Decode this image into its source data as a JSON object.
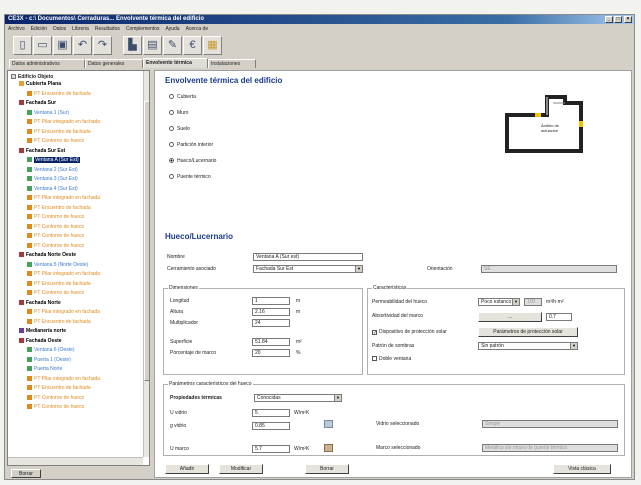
{
  "window": {
    "title": "CE3X - c:\\ Documentos\\ Cerraduras... Envolvente térmica del edificio"
  },
  "menu": [
    "Archivo",
    "Edición",
    "Datos",
    "Libreria",
    "Resultados",
    "Complementos",
    "Ayuda",
    "Acerca de"
  ],
  "tabs": [
    "Datos administrativos",
    "Datos generales",
    "Envolvente térmica",
    "Instalaciones"
  ],
  "tree": {
    "root": "Edificio Objeto",
    "items": [
      {
        "t": "Cubierta Plana",
        "d": 1,
        "c": "#000",
        "i": "#e2a23a",
        "b": true
      },
      {
        "t": "PT Encuentro de fachada",
        "d": 2,
        "c": "#e08a1e",
        "i": "#e08a1e"
      },
      {
        "t": "Fachada Sur",
        "d": 1,
        "c": "#000",
        "i": "#a63a3a",
        "b": true
      },
      {
        "t": "Ventana 1 (Sur)",
        "d": 2,
        "c": "#3a7acc",
        "i": "#4aa05a"
      },
      {
        "t": "PT Pilar integrado en fachada",
        "d": 2,
        "c": "#e08a1e",
        "i": "#e08a1e"
      },
      {
        "t": "PT Encuentro de fachada",
        "d": 2,
        "c": "#e08a1e",
        "i": "#e08a1e"
      },
      {
        "t": "PT Contorno de hueco",
        "d": 2,
        "c": "#e08a1e",
        "i": "#e08a1e"
      },
      {
        "t": "Fachada Sur Est",
        "d": 1,
        "c": "#000",
        "i": "#a63a3a",
        "b": true
      },
      {
        "t": "Ventana A (Sur Est)",
        "d": 2,
        "c": "#fff",
        "i": "#4aa05a",
        "s": true
      },
      {
        "t": "Ventana 2 (Sur Est)",
        "d": 2,
        "c": "#3a7acc",
        "i": "#4aa05a"
      },
      {
        "t": "Ventana 3 (Sur Est)",
        "d": 2,
        "c": "#3a7acc",
        "i": "#4aa05a"
      },
      {
        "t": "Ventana 4 (Sur Est)",
        "d": 2,
        "c": "#3a7acc",
        "i": "#4aa05a"
      },
      {
        "t": "PT Pilar integrado en fachada",
        "d": 2,
        "c": "#e08a1e",
        "i": "#e08a1e"
      },
      {
        "t": "PT Encuentro de fachada",
        "d": 2,
        "c": "#e08a1e",
        "i": "#e08a1e"
      },
      {
        "t": "PT Contorno de hueco",
        "d": 2,
        "c": "#e08a1e",
        "i": "#e08a1e"
      },
      {
        "t": "PT Contorno de hueco",
        "d": 2,
        "c": "#e08a1e",
        "i": "#e08a1e"
      },
      {
        "t": "PT Contorno de hueco",
        "d": 2,
        "c": "#e08a1e",
        "i": "#e08a1e"
      },
      {
        "t": "PT Contorno de hueco",
        "d": 2,
        "c": "#e08a1e",
        "i": "#e08a1e"
      },
      {
        "t": "Fachada Norte Oeste",
        "d": 1,
        "c": "#000",
        "i": "#a63a3a",
        "b": true
      },
      {
        "t": "Ventana 5 (Norte Oeste)",
        "d": 2,
        "c": "#3a7acc",
        "i": "#4aa05a"
      },
      {
        "t": "PT Pilar integrado en fachada",
        "d": 2,
        "c": "#e08a1e",
        "i": "#e08a1e"
      },
      {
        "t": "PT Encuentro de fachada",
        "d": 2,
        "c": "#e08a1e",
        "i": "#e08a1e"
      },
      {
        "t": "PT Contorno de hueco",
        "d": 2,
        "c": "#e08a1e",
        "i": "#e08a1e"
      },
      {
        "t": "Fachada Norte",
        "d": 1,
        "c": "#000",
        "i": "#a63a3a",
        "b": true
      },
      {
        "t": "PT Pilar integrado en fachada",
        "d": 2,
        "c": "#e08a1e",
        "i": "#e08a1e"
      },
      {
        "t": "PT Encuentro de fachada",
        "d": 2,
        "c": "#e08a1e",
        "i": "#e08a1e"
      },
      {
        "t": "Medianería norte",
        "d": 1,
        "c": "#000",
        "i": "#6a3aa6",
        "b": true
      },
      {
        "t": "Fachada Oeste",
        "d": 1,
        "c": "#000",
        "i": "#a63a3a",
        "b": true
      },
      {
        "t": "Ventana 6 (Oeste)",
        "d": 2,
        "c": "#3a7acc",
        "i": "#4aa05a"
      },
      {
        "t": "Puerta 1 (Oeste)",
        "d": 2,
        "c": "#3a7acc",
        "i": "#4aa05a"
      },
      {
        "t": "Puerta Norte",
        "d": 2,
        "c": "#3a7acc",
        "i": "#4aa05a"
      },
      {
        "t": "PT Pilar integrado en fachada",
        "d": 2,
        "c": "#e08a1e",
        "i": "#e08a1e"
      },
      {
        "t": "PT Encuentro de fachada",
        "d": 2,
        "c": "#e08a1e",
        "i": "#e08a1e"
      },
      {
        "t": "PT Contorno de hueco",
        "d": 2,
        "c": "#e08a1e",
        "i": "#e08a1e"
      },
      {
        "t": "PT Contorno de hueco",
        "d": 2,
        "c": "#e08a1e",
        "i": "#e08a1e"
      }
    ],
    "button": "Borrar"
  },
  "envolvente": {
    "title": "Envolvente térmica del edificio",
    "options": [
      "Cubierta",
      "Muro",
      "Suelo",
      "Partición interior",
      "Hueco/Lucernario",
      "Puente térmico"
    ],
    "selected": 4,
    "plan_label": "Ámbito de actuación"
  },
  "hueco": {
    "title": "Hueco/Lucernario",
    "nombre_label": "Nombre",
    "nombre": "Ventana A (Sur est)",
    "cerramiento_label": "Cerramiento asociado",
    "cerramiento": "Fachada Sur Est",
    "orientacion_label": "Orientación",
    "orientacion": "SE"
  },
  "dimensiones": {
    "title": "Dimensiones",
    "rows": [
      {
        "label": "Longitud",
        "value": "1",
        "unit": "m"
      },
      {
        "label": "Altura",
        "value": "2.16",
        "unit": "m"
      },
      {
        "label": "Multiplicador",
        "value": "24",
        "unit": ""
      },
      {
        "label": "Superficie",
        "value": "51.84",
        "unit": "m²"
      },
      {
        "label": "Porcentaje de marco",
        "value": "20",
        "unit": "%"
      }
    ]
  },
  "caracteristicas": {
    "title": "Características",
    "perm_label": "Permeabilidad del hueco",
    "perm_value": "Poco estanco",
    "perm_num": "100",
    "perm_unit": "m³/h·m²",
    "absort_label": "Absortividad del marco",
    "absort_btn": "...",
    "absort_value": "0.7",
    "proteccion_label": "Dispositivo de protección solar",
    "proteccion_checked": true,
    "proteccion_btn": "Parámetros de protección solar",
    "doble_label": "Doble ventana",
    "doble_checked": false,
    "patron_label": "Patrón de sombras",
    "patron_value": "Sin patrón"
  },
  "parametros": {
    "title": "Parámetros característicos del hueco",
    "prop_label": "Propiedades térmicas",
    "prop_value": "Conocidas",
    "rows": [
      {
        "label": "U vidrio",
        "value": "5",
        "unit": "W/m²K"
      },
      {
        "label": "g vidrio",
        "value": "0.85",
        "unit": ""
      },
      {
        "label": "U marco",
        "value": "5.7",
        "unit": "W/m²K"
      }
    ],
    "vidrio_label": "Vidrio seleccionado",
    "vidrio_value": "Simple",
    "marco_label": "Marco seleccionado",
    "marco_value": "Metálico sin rotura de puente térmico"
  },
  "buttons": {
    "anadir": "Añadir",
    "modificar": "Modificar",
    "borrar": "Borrar",
    "vista": "Vista clásica"
  },
  "colors": {
    "accent": "#1c3b8c",
    "title_bar": "#0a246a"
  }
}
